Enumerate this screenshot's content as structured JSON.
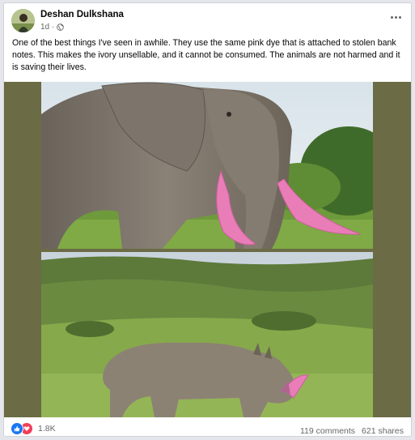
{
  "post": {
    "author": "Deshan Dulkshana",
    "timestamp": "1d ·",
    "privacy_icon": "globe-icon",
    "more_icon": "more-options-icon",
    "text": "One of the best things I've seen in awhile. They use the same pink dye that is attached to stolen bank notes. This makes the ivory unsellable, and it cannot be consumed. The animals are not harmed and it is saving their lives."
  },
  "media": {
    "images": [
      "elephant-with-pink-tusks",
      "rhino-with-pink-horn"
    ]
  },
  "footer": {
    "reaction_icons": [
      "like-icon",
      "love-icon"
    ],
    "reaction_count": "1.8K",
    "comments": "119 comments",
    "shares": "621 shares"
  },
  "colors": {
    "background": "#e4e6eb",
    "card": "#ffffff",
    "like": "#1877f2",
    "love": "#f33e58",
    "dye_pink": "#e87db8",
    "media_border": "#6b6b45"
  }
}
